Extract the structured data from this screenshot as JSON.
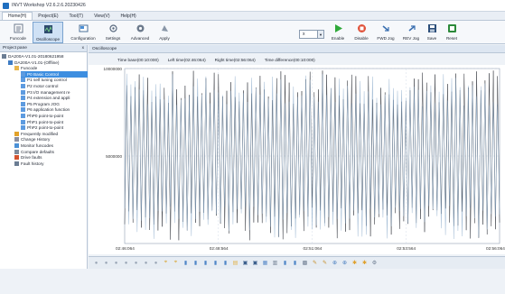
{
  "window": {
    "title": "INVT Workshop V2.6.2.6.20230426"
  },
  "menu": [
    {
      "label": "Home(H)",
      "active": true
    },
    {
      "label": "Project(E)",
      "active": false
    },
    {
      "label": "Tool(T)",
      "active": false
    },
    {
      "label": "View(V)",
      "active": false
    },
    {
      "label": "Help(H)",
      "active": false
    }
  ],
  "toolbar": {
    "funcode": "Funcode",
    "oscilloscope": "Oscilloscope",
    "configuration": "Configuration",
    "settings": "Settings",
    "advanced": "Advanced",
    "apply": "Apply",
    "combo_value": "x",
    "enable": "Enable",
    "disable": "Disable",
    "fwd_jog": "FWD Jog",
    "rev_jog": "REV Jog",
    "save": "Save",
    "reset": "Reset"
  },
  "project_pane": {
    "title": "Project pane",
    "pin": "x",
    "tree": [
      {
        "label": "DA200A-V1.01-20180621958",
        "indent": 0,
        "icon": "project-icon"
      },
      {
        "label": "DA200A-V1.01-(Offline)",
        "indent": 1,
        "icon": "device-icon"
      },
      {
        "label": "Funcode",
        "indent": 2,
        "icon": "folder-icon"
      },
      {
        "label": "P0 Basic Control",
        "indent": 3,
        "icon": "page-icon",
        "selected": true
      },
      {
        "label": "P1 self tuning control",
        "indent": 3,
        "icon": "page-icon"
      },
      {
        "label": "P2 motor control",
        "indent": 3,
        "icon": "page-icon"
      },
      {
        "label": "P3 I/O management re",
        "indent": 3,
        "icon": "page-icon"
      },
      {
        "label": "P4 extension and appli",
        "indent": 3,
        "icon": "page-icon"
      },
      {
        "label": "P5 Program JOG",
        "indent": 3,
        "icon": "page-icon"
      },
      {
        "label": "P6 application function",
        "indent": 3,
        "icon": "page-icon"
      },
      {
        "label": "PhP0 point-to-point",
        "indent": 3,
        "icon": "page-icon"
      },
      {
        "label": "PhP1 point-to-point",
        "indent": 3,
        "icon": "page-icon"
      },
      {
        "label": "PhP2 point-to-point",
        "indent": 3,
        "icon": "page-icon"
      },
      {
        "label": "Frequently modified",
        "indent": 2,
        "icon": "star-icon"
      },
      {
        "label": "Change History",
        "indent": 2,
        "icon": "history-icon"
      },
      {
        "label": "Monitor funcodes",
        "indent": 2,
        "icon": "monitor-icon"
      },
      {
        "label": "Compare defaults",
        "indent": 2,
        "icon": "compare-icon"
      },
      {
        "label": "Drive faults",
        "indent": 2,
        "icon": "fault-icon"
      },
      {
        "label": "Fault history",
        "indent": 2,
        "icon": "fault-history-icon"
      }
    ]
  },
  "oscilloscope": {
    "tab_label": "Oscilloscope",
    "time_base": "Time base(00:10:000)",
    "left_time": "Left time(02:46:064)",
    "right_time": "Right time(02:56:064)",
    "time_difference": "Time difference(00:10:000)"
  },
  "chart_data": {
    "type": "line",
    "title": "",
    "xlabel": "",
    "ylabel": "",
    "x_ticks": [
      "02:46:064",
      "02:48:564",
      "02:51:064",
      "02:53:564",
      "02:56:064"
    ],
    "y_ticks": [
      "10000000",
      "5000000",
      "0"
    ],
    "ylim": [
      0,
      10000000
    ],
    "grid": true,
    "series": [
      {
        "color": "#2b2f36",
        "style": "dense-oscillation",
        "center": 5000000,
        "amplitude": 4900000
      },
      {
        "color": "#8aa9c9",
        "style": "dense-oscillation",
        "center": 5000000,
        "amplitude": 4900000
      }
    ]
  },
  "bottom_tools": [
    "circle",
    "circle",
    "circle",
    "circle",
    "circle",
    "circle",
    "circle",
    "cursor",
    "cursor",
    "chart",
    "chart",
    "chart",
    "chart",
    "chart",
    "folder",
    "save",
    "save",
    "image",
    "print",
    "chart",
    "chart",
    "grid",
    "pin",
    "pin",
    "zoom",
    "zoom",
    "star",
    "star",
    "settings"
  ]
}
